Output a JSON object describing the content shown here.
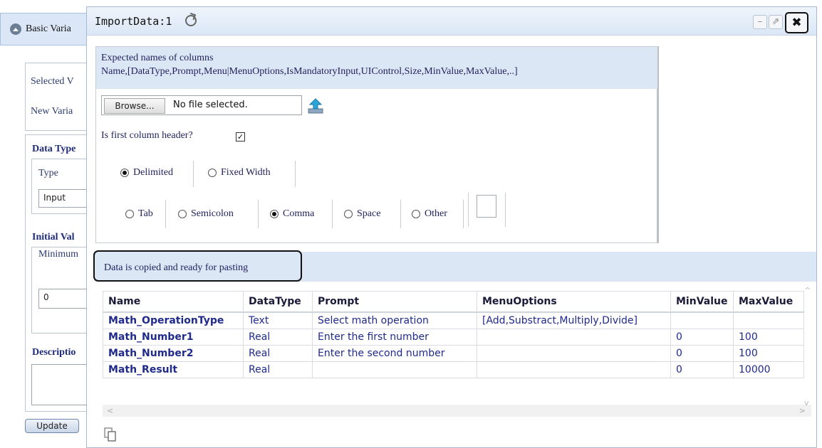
{
  "background": {
    "header_label": "Basic Varia",
    "selected_label": "Selected V",
    "new_variable_label": "New Varia",
    "data_type_heading": "Data Type",
    "type_label": "Type",
    "type_value": "Input",
    "initial_value_heading": "Initial Val",
    "minimum_label": "Minimum",
    "minimum_value": "0",
    "description_heading": "Descriptio",
    "update_label": "Update"
  },
  "dialog": {
    "title": "ImportData:1",
    "minimize_icon": "minimize-icon",
    "popout_icon": "popout-icon",
    "close_icon": "close-icon",
    "import": {
      "expected_line1": "Expected names of columns",
      "expected_line2": "Name,[DataType,Prompt,Menu|MenuOptions,IsMandatoryInput,UIControl,Size,MinValue,MaxValue,..]",
      "browse_label": "Browse...",
      "file_name": "No file selected.",
      "first_column_header_label": "Is first column header?",
      "first_column_header_checked": true,
      "format_options": [
        {
          "label": "Delimited",
          "selected": true
        },
        {
          "label": "Fixed Width",
          "selected": false
        }
      ],
      "delimiter_options": [
        {
          "label": "Tab",
          "selected": false
        },
        {
          "label": "Semicolon",
          "selected": false
        },
        {
          "label": "Comma",
          "selected": true
        },
        {
          "label": "Space",
          "selected": false
        },
        {
          "label": "Other",
          "selected": false
        }
      ],
      "other_value": ""
    },
    "status_message": "Data is copied and ready for pasting",
    "table": {
      "columns": [
        "Name",
        "DataType",
        "Prompt",
        "MenuOptions",
        "MinValue",
        "MaxValue"
      ],
      "rows": [
        [
          "Math_OperationType",
          "Text",
          "Select math operation",
          "[Add,Substract,Multiply,Divide]",
          "",
          ""
        ],
        [
          "Math_Number1",
          "Real",
          "Enter the first number",
          "",
          "0",
          "100"
        ],
        [
          "Math_Number2",
          "Real",
          "Enter the second number",
          "",
          "0",
          "100"
        ],
        [
          "Math_Result",
          "Real",
          "",
          "",
          "0",
          "10000"
        ]
      ]
    },
    "copy_icon": "copy-icon"
  },
  "colors": {
    "header_bg": "#dce7f6",
    "link_text": "#1f2a8a",
    "border": "#a4b9d3"
  }
}
